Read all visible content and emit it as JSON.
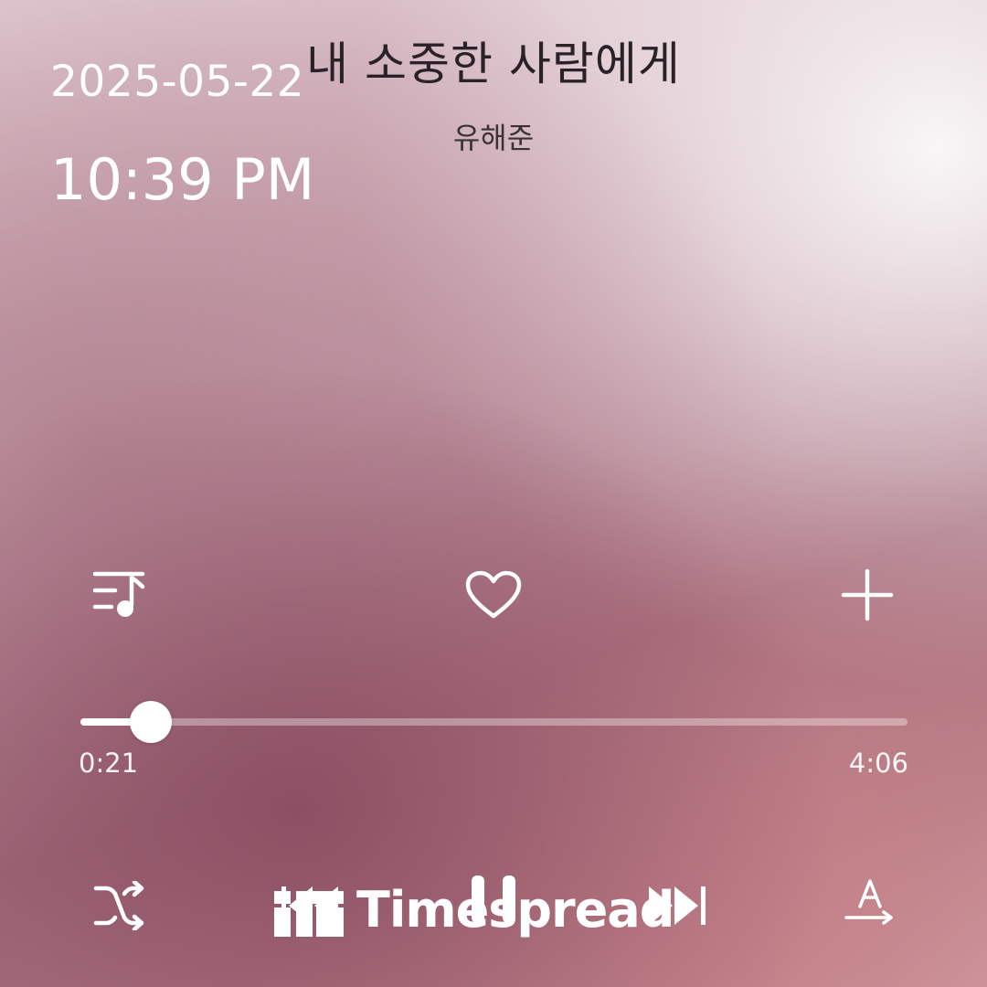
{
  "overlay": {
    "date": "2025-05-22",
    "time": "10:39 PM"
  },
  "track": {
    "title": "내 소중한 사람에게",
    "artist": "유해준"
  },
  "progress": {
    "elapsed": "0:21",
    "duration": "4:06",
    "fraction": 0.085
  },
  "actions": {
    "playlist_icon": "playlist-music-icon",
    "like_icon": "heart-icon",
    "add_icon": "plus-icon"
  },
  "controls": {
    "shuffle_icon": "shuffle-icon",
    "previous_icon": "previous-icon",
    "pause_icon": "pause-icon",
    "next_icon": "next-icon",
    "lyrics_icon": "translate-lyrics-icon"
  },
  "watermark": {
    "text": "Timespread"
  },
  "colors": {
    "foreground": "#ffffff",
    "title_text": "#2a2228"
  }
}
